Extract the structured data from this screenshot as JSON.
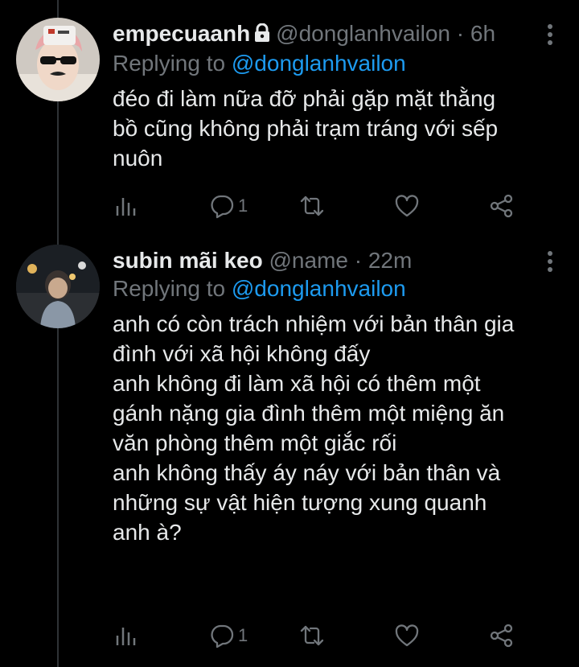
{
  "tweets": [
    {
      "display_name": "empecuaanh",
      "handle": "@donglanhvailon",
      "separator": "·",
      "time": "6h",
      "replying_prefix": "Replying to",
      "replying_to": "@donglanhvailon",
      "text": "đéo đi làm nữa đỡ phải gặp mặt thằng\nbồ cũng không phải trạm tráng với sếp\nnuôn",
      "reply_count": "1",
      "protected": true
    },
    {
      "display_name": "subin mãi keo",
      "handle": "@name",
      "separator": "·",
      "time": "22m",
      "replying_prefix": "Replying to",
      "replying_to": "@donglanhvailon",
      "text": "anh có còn trách nhiệm với bản thân gia\nđình với xã hội không đấy\nanh không đi làm xã hội có thêm một\ngánh nặng gia đình thêm một miệng ăn\nvăn phòng thêm một giắc rối\nanh không thấy áy náy với bản thân và\nnhững sự vật hiện tượng xung quanh\nanh à?",
      "reply_count": "1",
      "protected": false
    }
  ],
  "colors": {
    "background": "#000000",
    "text": "#e7e9ea",
    "secondary": "#71767b",
    "accent": "#1d9bf0"
  },
  "icons": [
    "lock-icon",
    "more-icon",
    "analytics-icon",
    "reply-icon",
    "retweet-icon",
    "like-icon",
    "share-icon"
  ]
}
